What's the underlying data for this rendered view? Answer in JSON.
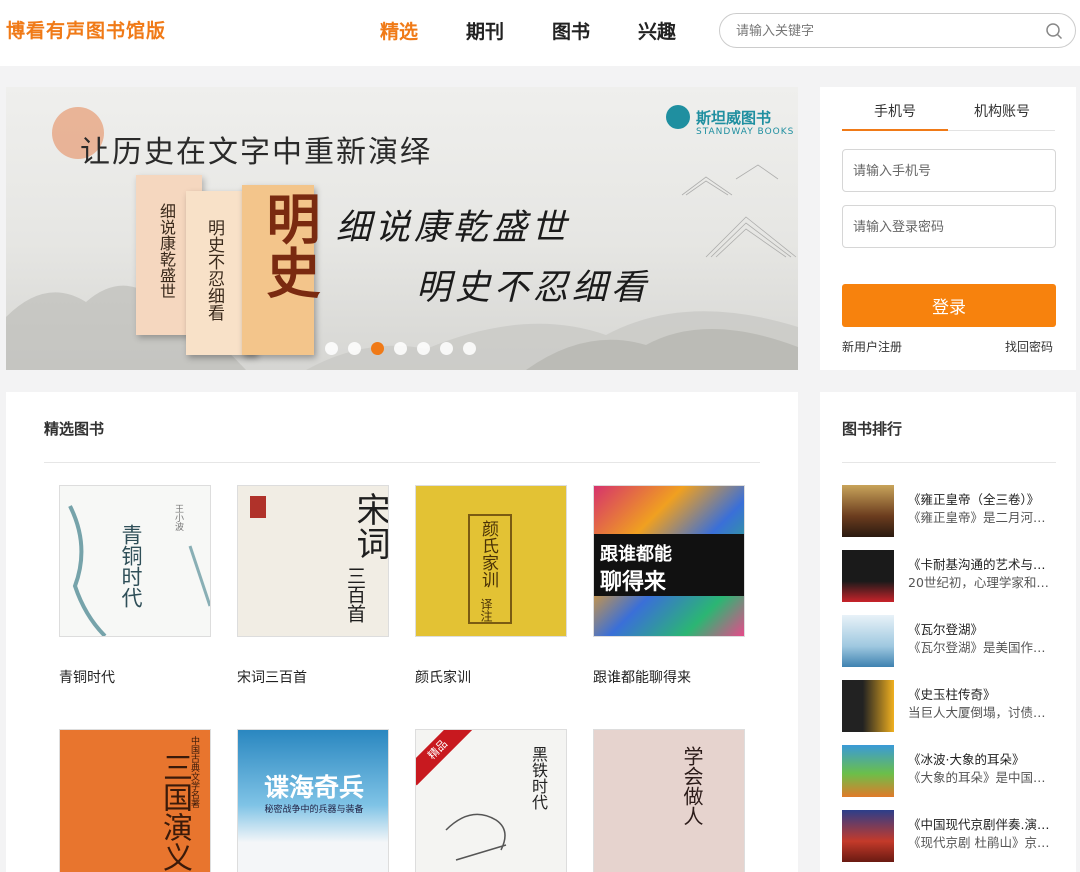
{
  "header": {
    "logo": "博看有声图书馆版",
    "nav": [
      "精选",
      "期刊",
      "图书",
      "兴趣"
    ],
    "search_placeholder": "请输入关键字"
  },
  "banner": {
    "title": "让历史在文字中重新演绎",
    "brand": "斯坦威图书",
    "brand_sub": "STANDWAY BOOKS",
    "line1": "细说康乾盛世",
    "line2": "明史不忍细看",
    "book1": "细说康乾盛世",
    "book2": "明史不忍细看",
    "book3": "明史",
    "slide_count": 7,
    "active_slide": 3
  },
  "login": {
    "tabs": [
      "手机号",
      "机构账号"
    ],
    "phone_placeholder": "请输入手机号",
    "password_placeholder": "请输入登录密码",
    "submit": "登录",
    "register": "新用户注册",
    "forgot": "找回密码"
  },
  "featured": {
    "title": "精选图书",
    "books": [
      {
        "name": "青铜时代",
        "cover_text": "青铜时代",
        "cover_author": "王小波"
      },
      {
        "name": "宋词三百首",
        "cover_text": "宋词",
        "cover_text2": "三百首"
      },
      {
        "name": "颜氏家训",
        "cover_text": "颜氏家训",
        "cover_text2": "译注"
      },
      {
        "name": "跟谁都能聊得来",
        "cover_text": "跟谁都能",
        "cover_text2": "聊得来"
      },
      {
        "name": "",
        "cover_text": "三国演义",
        "cover_text2": "中国古典文学名著"
      },
      {
        "name": "",
        "cover_text": "谍海奇兵",
        "cover_text2": "秘密战争中的兵器与装备"
      },
      {
        "name": "",
        "cover_text": "黑铁时代",
        "badge": "精品"
      },
      {
        "name": "",
        "cover_text": "学会做人"
      }
    ]
  },
  "ranking": {
    "title": "图书排行",
    "items": [
      {
        "name": "《雍正皇帝（全三卷）》",
        "desc": "《雍正皇帝》是二月河…"
      },
      {
        "name": "《卡耐基沟通的艺术与…",
        "desc": "20世纪初，心理学家和…"
      },
      {
        "name": "《瓦尔登湖》",
        "desc": "《瓦尔登湖》是美国作…"
      },
      {
        "name": "《史玉柱传奇》",
        "desc": "当巨人大厦倒塌，讨债…"
      },
      {
        "name": "《冰波·大象的耳朵》",
        "desc": "《大象的耳朵》是中国…"
      },
      {
        "name": "《中国现代京剧伴奏.演…",
        "desc": "《现代京剧 杜鹃山》京…"
      }
    ]
  },
  "colors": {
    "accent": "#f07a17",
    "button": "#f7820d"
  }
}
